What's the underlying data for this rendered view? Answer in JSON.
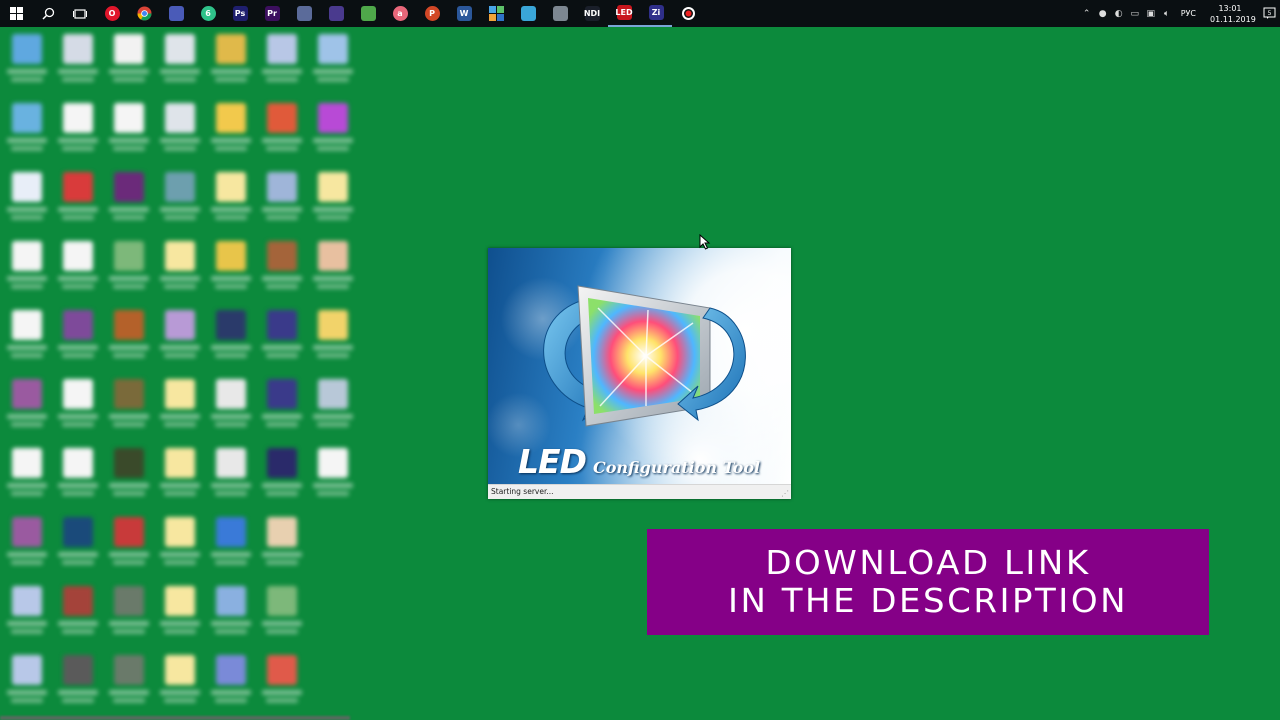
{
  "taskbar": {
    "apps": [
      {
        "name": "start-button",
        "icon": "windows-logo-icon",
        "color": "#ffffff",
        "glyph": "",
        "active": false
      },
      {
        "name": "search-button",
        "icon": "search-icon",
        "color": "#ffffff",
        "glyph": "",
        "active": false
      },
      {
        "name": "task-view-button",
        "icon": "task-view-icon",
        "color": "#ffffff",
        "glyph": "",
        "active": false
      },
      {
        "name": "opera-app",
        "icon": "opera-icon",
        "color": "#e0162b",
        "glyph": "O",
        "active": false,
        "round": true
      },
      {
        "name": "chrome-app",
        "icon": "chrome-icon",
        "color": "#f2b40f",
        "glyph": "",
        "active": false,
        "round": true
      },
      {
        "name": "video-editor-app",
        "icon": "clapper-icon",
        "color": "#4a5bb8",
        "glyph": "",
        "active": false
      },
      {
        "name": "green-app",
        "icon": "green-swirl-icon",
        "color": "#2fc28a",
        "glyph": "6",
        "active": false,
        "round": true
      },
      {
        "name": "photoshop-app",
        "icon": "photoshop-icon",
        "color": "#1f1f6e",
        "glyph": "Ps",
        "active": false
      },
      {
        "name": "premiere-app",
        "icon": "premiere-icon",
        "color": "#3c0f5e",
        "glyph": "Pr",
        "active": false
      },
      {
        "name": "media-app",
        "icon": "media-icon",
        "color": "#5b6b9a",
        "glyph": "",
        "active": false
      },
      {
        "name": "purple-app",
        "icon": "purple-app-icon",
        "color": "#4a3a8e",
        "glyph": "",
        "active": false
      },
      {
        "name": "vpn-app",
        "icon": "shield-icon",
        "color": "#4fa84a",
        "glyph": "",
        "active": false
      },
      {
        "name": "a-app",
        "icon": "a-letter-icon",
        "color": "#e8677a",
        "glyph": "a",
        "active": false,
        "round": true
      },
      {
        "name": "powerpoint-app",
        "icon": "powerpoint-icon",
        "color": "#d24726",
        "glyph": "P",
        "active": false,
        "round": true
      },
      {
        "name": "word-app",
        "icon": "word-icon",
        "color": "#2b579a",
        "glyph": "W",
        "active": false
      },
      {
        "name": "grid-app",
        "icon": "grid-icon",
        "color": "#2f93d8",
        "glyph": "",
        "active": false
      },
      {
        "name": "network-app",
        "icon": "network-icon",
        "color": "#3aa6d8",
        "glyph": "",
        "active": false
      },
      {
        "name": "tools-app",
        "icon": "tools-icon",
        "color": "#7d8791",
        "glyph": "",
        "active": false
      },
      {
        "name": "ndi-app",
        "icon": "ndi-icon",
        "color": "#1a1f2a",
        "glyph": "NDI",
        "active": false
      },
      {
        "name": "led-app",
        "icon": "led-icon",
        "color": "#c8161d",
        "glyph": "LED",
        "active": true
      },
      {
        "name": "zi-app",
        "icon": "zi-icon",
        "color": "#2f2f8a",
        "glyph": "Zi",
        "active": true
      },
      {
        "name": "record-app",
        "icon": "record-icon",
        "color": "#ffffff",
        "glyph": "",
        "active": false,
        "round": true
      }
    ],
    "tray": {
      "lang": "РУС",
      "time": "13:01",
      "date": "01.11.2019",
      "notification_count": "5"
    }
  },
  "desktop": {
    "icon_colors": [
      "#5fa8e0",
      "#d5dbe6",
      "#f2f2f2",
      "#dfe4ea",
      "#e0b94a",
      "#b8c7e6",
      "#9fc3e8",
      "#69b2e0",
      "#f5f5f5",
      "#f5f5f5",
      "#dfe4ea",
      "#f2c94c",
      "#e05a3a",
      "#b84ad6",
      "#e8eef8",
      "#d93b3b",
      "#6b2a7a",
      "#6d9fae",
      "#f7e7a0",
      "#9fb5d9",
      "#f7e7a0",
      "#f5f5f5",
      "#f5f5f5",
      "#7db87a",
      "#f7e7a0",
      "#e8c54a",
      "#a4643a",
      "#e8c0a0",
      "#f5f5f5",
      "#7e4a9a",
      "#b4612a",
      "#b89ad6",
      "#2a3a6a",
      "#3a3a8a",
      "#f2d36a",
      "#9a5aa0",
      "#f5f5f5",
      "#7a6a3a",
      "#f7e7a0",
      "#e8e8e8",
      "#3a3a8a",
      "#b8c8d8",
      "#f5f5f5",
      "#f5f5f5",
      "#3a4a2a",
      "#f7e7a0",
      "#e8e8e8",
      "#2a2a6a",
      "#f5f5f5",
      "#9a5aa0",
      "#1a4a7a",
      "#c83a3a",
      "#f7e7a0",
      "#3a7ad8",
      "#e8d0b0",
      "#0c8a3c",
      "#b8c8e8",
      "#a4433a",
      "#6a7a6a",
      "#f7e7a0",
      "#8ab0e0",
      "#7db87a",
      "#0c8a3c",
      "#b8c8e8",
      "#5a5a5a",
      "#6a7a6a",
      "#f7e7a0",
      "#7a8ad8",
      "#e05a4a",
      "#0c8a3c"
    ]
  },
  "splash": {
    "title_big": "LED",
    "title_small": "Configuration Tool",
    "status": "Starting server..."
  },
  "banner": {
    "line1": "DOWNLOAD LINK",
    "line2": "IN THE DESCRIPTION",
    "color": "#850087"
  }
}
